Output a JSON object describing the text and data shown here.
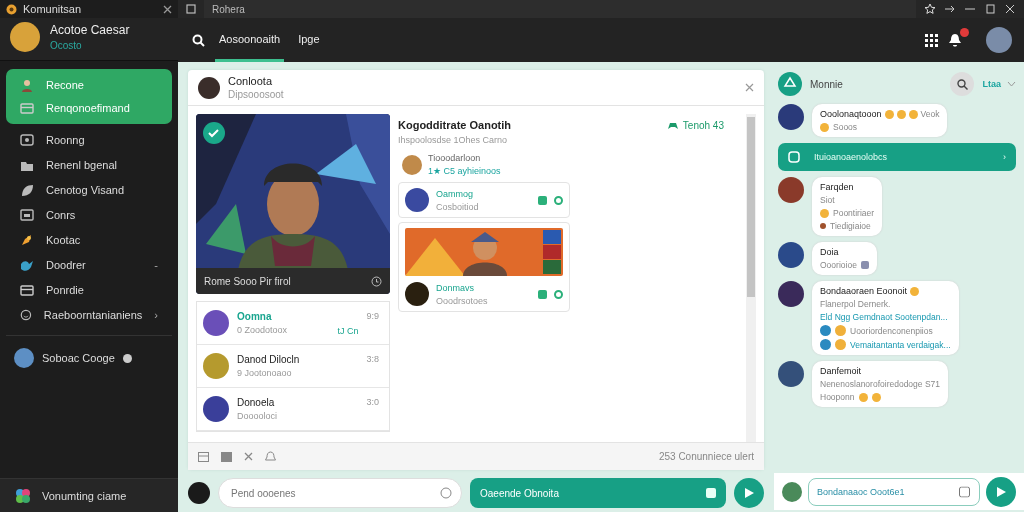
{
  "app": {
    "title": "Komunitsan",
    "user": {
      "name": "Acotoe Caesar",
      "status": "Ocosto"
    }
  },
  "nav": [
    {
      "label": "Recone",
      "selected": true
    },
    {
      "label": "Renqonoefimand",
      "selected": true
    },
    {
      "label": "Roonng",
      "selected": false
    },
    {
      "label": "Renenl bgenal",
      "selected": false
    },
    {
      "label": "Cenotog Visand",
      "selected": false
    },
    {
      "label": "Conrs",
      "selected": false
    },
    {
      "label": "Kootac",
      "selected": false
    },
    {
      "label": "Doodrer",
      "selected": false,
      "trail": "-"
    },
    {
      "label": "Ponrdie",
      "selected": false
    },
    {
      "label": "Raeboorntanianiens",
      "selected": false,
      "trail": "›"
    }
  ],
  "group": {
    "label": "Soboac Cooge"
  },
  "footer": {
    "label": "Vonumting ciame"
  },
  "address_bar": {
    "value": "Rohera"
  },
  "tabs": [
    {
      "label": "Aosoonoaith",
      "selected": true
    },
    {
      "label": "Ipge",
      "selected": false
    }
  ],
  "post": {
    "author": "Conloota",
    "subtitle": "Dipsooosoot",
    "picture_caption": "Rome Sooo Pir firol",
    "title": "Kogodditrate Oanotih",
    "description": "Ihspoolosdse 1Ohes Carno",
    "person": "Tiooodarloon",
    "stats": "1★ C5 ayhieinoos",
    "badge": "Tenoh 43",
    "cards": [
      {
        "kind": "contact",
        "name": "Oammog",
        "sub": "Cosboitiod"
      },
      {
        "kind": "banner",
        "name": "Donmavs",
        "sub": "Ooodrsotoes"
      }
    ],
    "rows": [
      {
        "name": "Oomna",
        "sub": "0 Zoodotoox",
        "time": "9:9",
        "extra": "tJ Cn",
        "highlight": true
      },
      {
        "name": "Danod Dilocln",
        "sub": "9 Jootonoaoo",
        "time": "3:8",
        "highlight": false
      },
      {
        "name": "Donoela",
        "sub": "Dooooloci",
        "time": "3:0",
        "highlight": false
      }
    ],
    "status": "253 Conunniece ulert"
  },
  "composer": {
    "placeholder": "Pend oooenes",
    "action": "Oaeende Obnoita"
  },
  "chat": {
    "title": "Monnie",
    "filter": "Ltaa",
    "messages": [
      {
        "kind": "message",
        "name": "Ooolonaqtooon",
        "tail": "Veok",
        "lines": [
          {
            "text": "Sooos"
          }
        ]
      },
      {
        "kind": "banner",
        "text": "Ituioanoaenolobcs",
        "trail": "›"
      },
      {
        "kind": "message",
        "name": "Farqden",
        "lines": [
          {
            "text": "Siot"
          },
          {
            "text": "Poontiriaer"
          },
          {
            "text": "Tiedigiaioe"
          }
        ]
      },
      {
        "kind": "message",
        "name": "Doia",
        "lines": [
          {
            "text": "Ooorioioe"
          }
        ]
      },
      {
        "kind": "message",
        "name": "Bondaaoraen Eoonoit",
        "lines": [
          {
            "text": "Flanerpol Dernerk."
          },
          {
            "text": "Eld Ngg Gemdnaot Sootenpdan...",
            "link": true
          },
          {
            "text": "Uooriordenconenpiios"
          },
          {
            "text": "Vemaitantanta verdaigak...",
            "link": true
          }
        ]
      },
      {
        "kind": "message",
        "name": "Danfemoit",
        "lines": [
          {
            "text": "Nenenoslanorofoiredodoge S71"
          },
          {
            "text": "Hooponn"
          }
        ]
      }
    ],
    "input": "Bondanaaoc Ooot6e1"
  }
}
